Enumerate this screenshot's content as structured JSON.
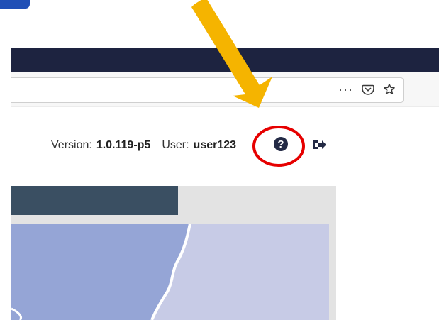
{
  "header": {
    "version_label": "Version:",
    "version_value": "1.0.119-p5",
    "user_label": "User:",
    "user_value": "user123"
  },
  "browser": {
    "more_icon": "more-icon",
    "pocket_icon": "pocket-icon",
    "star_icon": "star-icon"
  },
  "icons": {
    "help": "help-icon",
    "logout": "logout-icon"
  },
  "colors": {
    "dark_bar": "#1d2340",
    "map_header": "#3a4f62",
    "map_left": "#95a5d6",
    "map_right": "#c7cbe6",
    "arrow": "#f5b400",
    "highlight": "#e60000"
  }
}
